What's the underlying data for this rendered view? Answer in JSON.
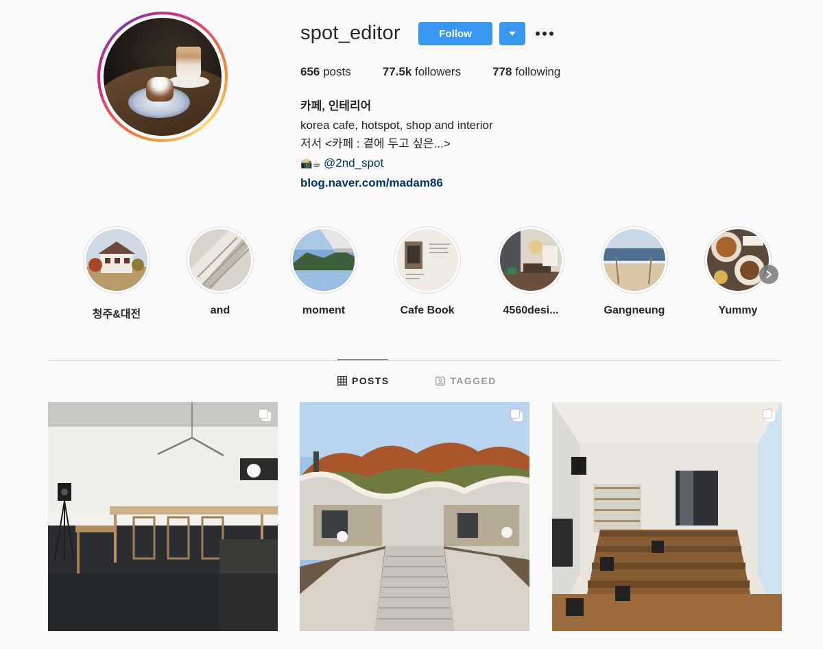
{
  "profile": {
    "username": "spot_editor",
    "follow_label": "Follow",
    "stats": {
      "posts_count": "656",
      "posts_label": " posts",
      "followers_count": "77.5k",
      "followers_label": " followers",
      "following_count": "778",
      "following_label": " following"
    },
    "bio": {
      "name": "카페, 인테리어",
      "line1": "korea cafe, hotspot, shop and interior",
      "line2": "저서 <카페 : 곁에 두고 싶은...>",
      "line3_emoji": "📸☕",
      "mention": "@2nd_spot",
      "link": "blog.naver.com/madam86"
    }
  },
  "highlights": [
    {
      "label": "청주&대전",
      "icon": "house-icon"
    },
    {
      "label": "and",
      "icon": "building-icon"
    },
    {
      "label": "moment",
      "icon": "landscape-icon"
    },
    {
      "label": "Cafe Book",
      "icon": "book-icon"
    },
    {
      "label": "4560desi...",
      "icon": "interior-icon"
    },
    {
      "label": "Gangneung",
      "icon": "beach-icon"
    },
    {
      "label": "Yummy",
      "icon": "food-icon"
    }
  ],
  "tabs": [
    {
      "label": "POSTS",
      "icon": "grid-icon",
      "active": true
    },
    {
      "label": "TAGGED",
      "icon": "tag-person-icon",
      "active": false
    }
  ],
  "posts": [
    {
      "type": "carousel",
      "scene": "minimal cafe interior with long wooden tables"
    },
    {
      "type": "carousel",
      "scene": "stone stairway to curved roof building in autumn"
    },
    {
      "type": "carousel",
      "scene": "bookshop interior with wooden bleacher seating"
    }
  ],
  "colors": {
    "accent": "#3897f0",
    "link": "#003569",
    "background": "#fafafa",
    "text": "#262626",
    "muted": "#999999"
  }
}
